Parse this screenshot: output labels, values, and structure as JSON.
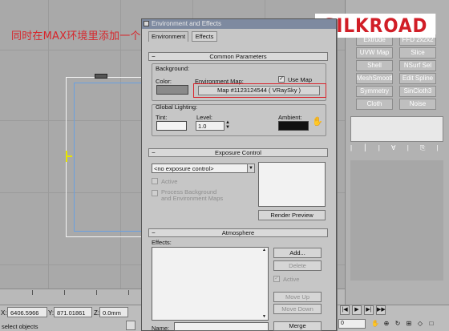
{
  "caption": "同时在MAX环境里添加一个默认的VRSkay 不需要更改参数",
  "logo": "SILKROAD",
  "dialog": {
    "title": "Environment and Effects",
    "tabs": [
      "Environment",
      "Effects"
    ],
    "common": {
      "header": "Common Parameters",
      "background_label": "Background:",
      "color_label": "Color:",
      "env_map_label": "Environment Map:",
      "use_map_label": "Use Map",
      "use_map_checked": true,
      "map_button": "Map #1123124544  ( VRaySky )",
      "global_lighting_label": "Global Lighting:",
      "tint_label": "Tint:",
      "level_label": "Level:",
      "level_value": "1.0",
      "ambient_label": "Ambient:",
      "background_color": "#8a8a8a",
      "tint_color": "#f4f4f4",
      "ambient_color": "#111111"
    },
    "exposure": {
      "header": "Exposure Control",
      "dropdown_value": "<no exposure control>",
      "active_label": "Active",
      "process_label_1": "Process Background",
      "process_label_2": "and Environment Maps",
      "render_preview": "Render Preview"
    },
    "atmosphere": {
      "header": "Atmosphere",
      "effects_label": "Effects:",
      "add": "Add...",
      "delete": "Delete",
      "active_label": "Active",
      "move_up": "Move Up",
      "move_down": "Move Down",
      "name_label": "Name:",
      "merge": "Merge"
    }
  },
  "command_panel": {
    "modifiers": [
      [
        "Extrude",
        "FFD 2x2x2"
      ],
      [
        "UVW Map",
        "Slice"
      ],
      [
        "Shell",
        "NSurf Sel"
      ],
      [
        "MeshSmooth",
        "Edit Spline"
      ],
      [
        "Symmetry",
        "SinCloth3"
      ],
      [
        "Cloth",
        "Noise"
      ]
    ],
    "stack_tools": "| ⎮ | ∀ | ⎘ | ⌂"
  },
  "status": {
    "x_label": "X:",
    "x_value": "6406.5966",
    "y_label": "Y:",
    "y_value": "871.01861",
    "z_label": "Z:",
    "z_value": "0.0mm",
    "message": "select objects",
    "frame": "0"
  }
}
